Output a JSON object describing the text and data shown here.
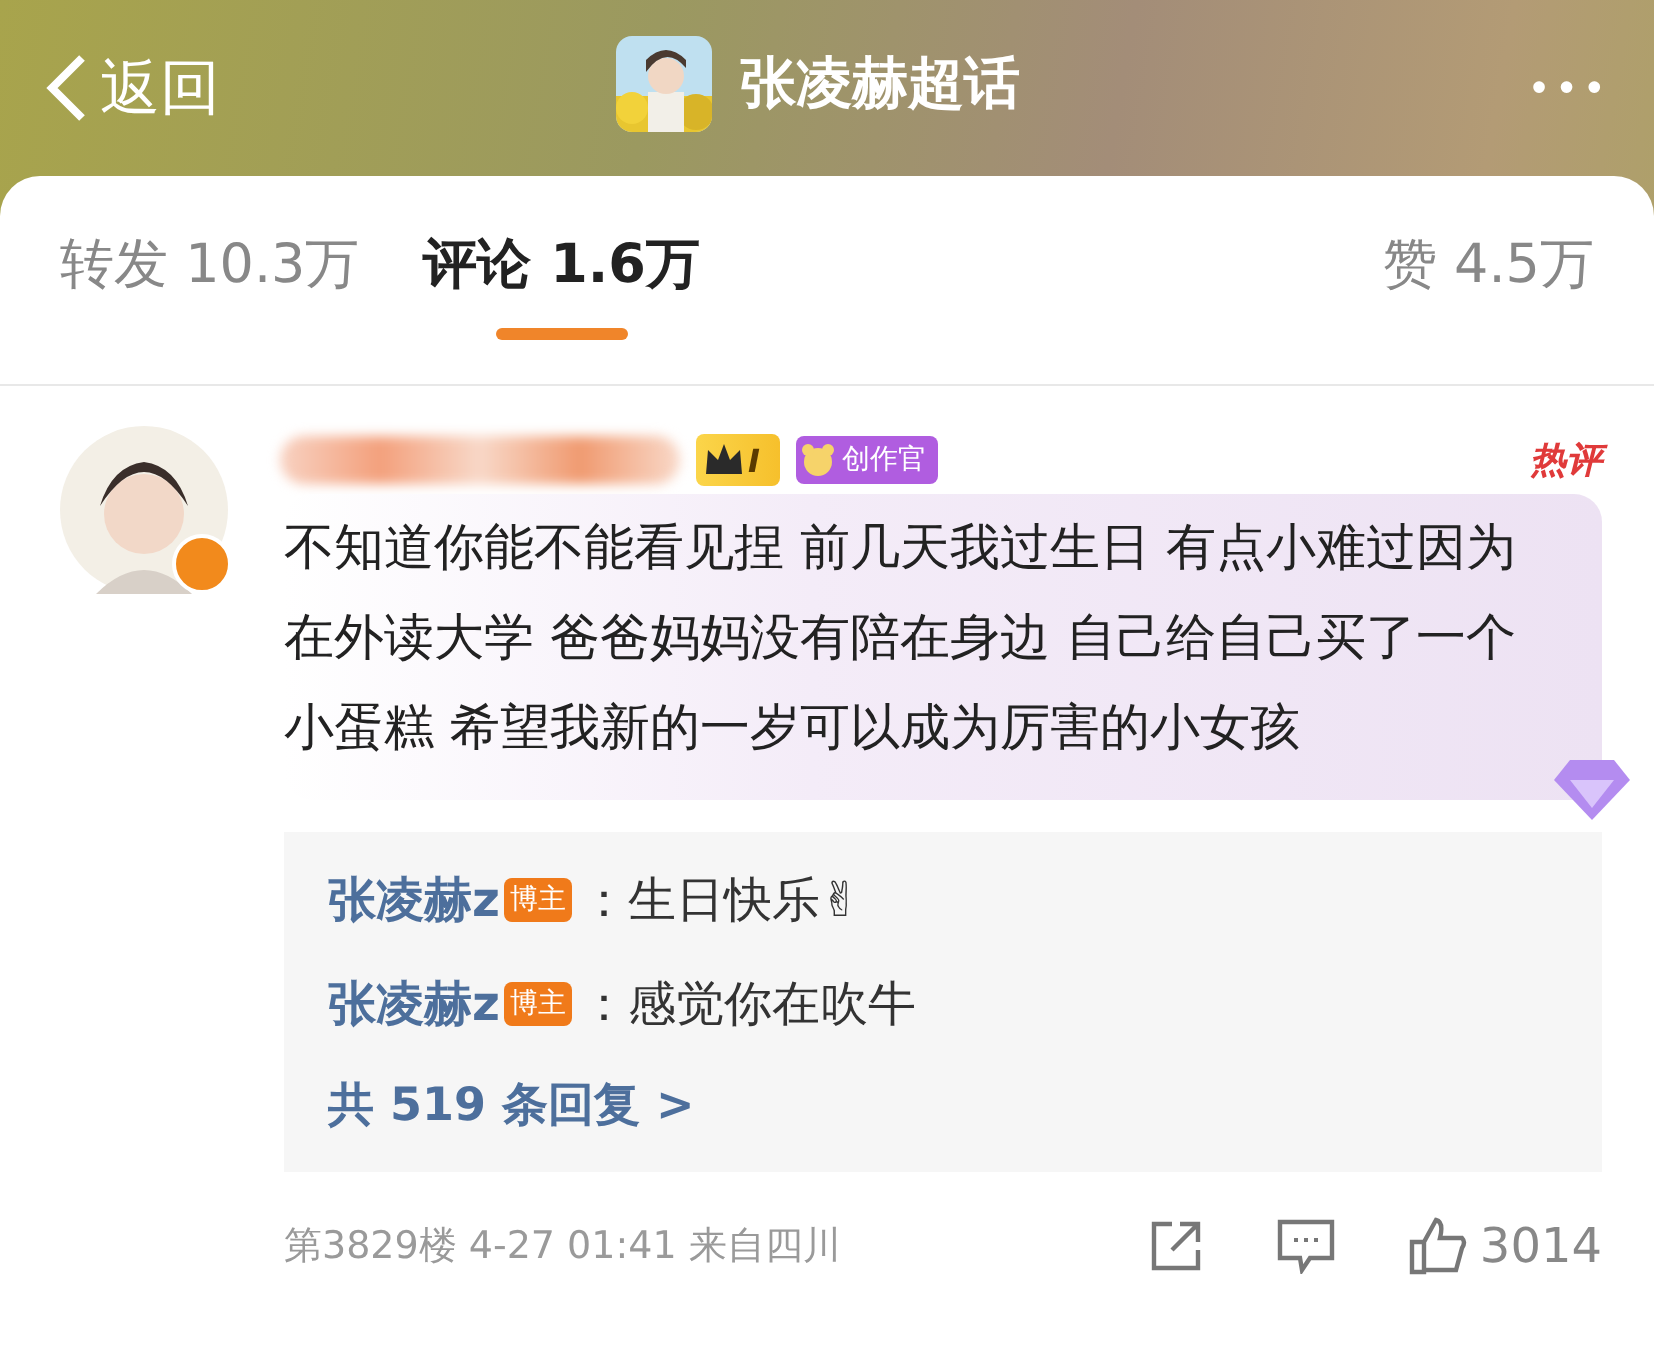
{
  "header": {
    "back": "返回",
    "title": "张凌赫超话",
    "more": "•••"
  },
  "tabs": [
    {
      "label": "转发 10.3万",
      "selected": false
    },
    {
      "label": "评论 1.6万",
      "selected": true
    },
    {
      "label": "赞 4.5万",
      "selected": false
    }
  ],
  "comment": {
    "level_badge": "I",
    "role_badge": "创作官",
    "hot_tag": "热评",
    "verified": true,
    "text": "不知道你能不能看见捏 前几天我过生日 有点小难过因为在外读大学 爸爸妈妈没有陪在身边 自己给自己买了一个小蛋糕 希望我新的一岁可以成为厉害的小女孩",
    "replies": [
      {
        "author": "张凌赫z",
        "badge": "博主",
        "text": "：生日快乐✌"
      },
      {
        "author": "张凌赫z",
        "badge": "博主",
        "text": "：感觉你在吹牛"
      }
    ],
    "more_replies": "共 519 条回复 >",
    "floor": "第3829楼 4-27 01:41 来自四川",
    "likes": "3014"
  }
}
